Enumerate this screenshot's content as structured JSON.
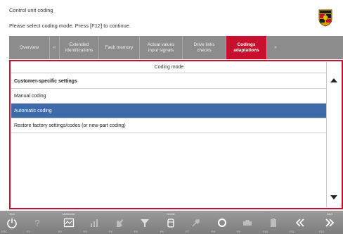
{
  "header": {
    "title": "Control unit coding",
    "instruction": "Please select coding mode. Press [F12] to continue."
  },
  "tabs": [
    {
      "label": "Overview",
      "active": false
    },
    {
      "label": "«",
      "active": false
    },
    {
      "label": "Extended\nidentifications",
      "active": false
    },
    {
      "label": "Fault memory",
      "active": false
    },
    {
      "label": "Actual values\ninput signals",
      "active": false
    },
    {
      "label": "Drive links\nchecks",
      "active": false
    },
    {
      "label": "Codings\nadaptations",
      "active": true
    },
    {
      "label": "»",
      "active": false
    }
  ],
  "list": {
    "header": "Coding mode",
    "items": [
      {
        "label": "Customer-specific settings",
        "bold": true,
        "selected": false
      },
      {
        "label": "Manual coding",
        "bold": false,
        "selected": false
      },
      {
        "label": "Automatic coding",
        "bold": false,
        "selected": true
      },
      {
        "label": "Restore factory settings/codes (or new-part coding)",
        "bold": false,
        "selected": false
      },
      {
        "label": "",
        "bold": false,
        "selected": false
      }
    ]
  },
  "footer": {
    "keys": [
      {
        "caption": "End",
        "num": "ESC",
        "icon": "power-icon"
      },
      {
        "caption": "",
        "num": "F1",
        "icon": "help-icon"
      },
      {
        "caption": "Multimeter",
        "num": "F2",
        "icon": "multimeter-icon"
      },
      {
        "caption": "",
        "num": "F3",
        "icon": "signal-icon"
      },
      {
        "caption": "",
        "num": "F4",
        "icon": "hand-icon"
      },
      {
        "caption": "",
        "num": "F5",
        "icon": "filter-icon"
      },
      {
        "caption": "Delete",
        "num": "F6",
        "icon": "delete-icon"
      },
      {
        "caption": "",
        "num": "F7",
        "icon": "tool-icon"
      },
      {
        "caption": "",
        "num": "F8",
        "icon": "record-icon"
      },
      {
        "caption": "",
        "num": "F9",
        "icon": "camera-icon"
      },
      {
        "caption": "",
        "num": "F10",
        "icon": "card-icon"
      },
      {
        "caption": "",
        "num": "F11",
        "icon": "back-icon"
      },
      {
        "caption": "Next",
        "num": "F12",
        "icon": "next-icon"
      }
    ]
  },
  "colors": {
    "accent": "#c8102e",
    "selection": "#3d6aa8",
    "tabbar": "#8c8c8c",
    "footer": "#8a8a8a"
  }
}
